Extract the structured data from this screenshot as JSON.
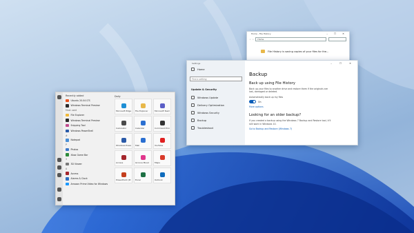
{
  "start_menu": {
    "recently_added_header": "Recently added",
    "recent": [
      {
        "label": "Ubuntu 20.04 LTS",
        "color": "#e95420"
      },
      {
        "label": "Windows Terminal Preview",
        "color": "#2b2b2b"
      }
    ],
    "most_used_header": "Most used",
    "most_used": [
      {
        "label": "File Explorer",
        "color": "#f0b93a"
      },
      {
        "label": "Windows Terminal Preview",
        "color": "#2b2b2b"
      },
      {
        "label": "Snipping Tool",
        "color": "#c14a8e"
      },
      {
        "label": "Windows PowerShell",
        "color": "#2a5aa8"
      }
    ],
    "section_hash": "#",
    "hash_items": [
      {
        "label": "Notepad",
        "color": "#4a8fd6"
      }
    ],
    "section_p": "P",
    "p_items": [
      {
        "label": "Photos",
        "color": "#3b78c9"
      },
      {
        "label": "Xbox Game Bar",
        "color": "#2c8a3a"
      }
    ],
    "section_3": "3",
    "three_items": [
      {
        "label": "3D Viewer",
        "color": "#7a7a7a"
      }
    ],
    "section_a": "A",
    "a_items": [
      {
        "label": "Access",
        "color": "#a4262c"
      },
      {
        "label": "Alarms & Clock",
        "color": "#2e6fc0"
      },
      {
        "label": "Amazon Prime Video for Windows",
        "color": "#1a98ff"
      }
    ],
    "tiles_header": "Daily",
    "tiles": [
      {
        "label": "Microsoft Edge",
        "color": "#1e8fd5"
      },
      {
        "label": "File Explorer",
        "color": "#e8b84a"
      },
      {
        "label": "Microsoft Teams",
        "color": "#5b5fc7"
      },
      {
        "label": "Calculator",
        "color": "#4a4a4a"
      },
      {
        "label": "Calendar",
        "color": "#2a6fd1"
      },
      {
        "label": "Command Prompt",
        "color": "#333333"
      },
      {
        "label": "Windows PowerShell",
        "color": "#2a5aa8"
      },
      {
        "label": "Mail",
        "color": "#2a6fd1"
      },
      {
        "label": "YouTube",
        "color": "#e02020"
      },
      {
        "label": "Access",
        "color": "#a4262c"
      },
      {
        "label": "Groove Music",
        "color": "#e0368c"
      },
      {
        "label": "Maps",
        "color": "#d93a2a"
      },
      {
        "label": "PowerPoint (Preview)",
        "color": "#c43e1c"
      },
      {
        "label": "Excel",
        "color": "#1d7044"
      },
      {
        "label": "Outlook",
        "color": "#0f6cbd"
      }
    ]
  },
  "explorer": {
    "title": "Home - File History",
    "controls": "– ☐ ✕",
    "address": "Home",
    "message": "File History is saving copies of your files for the..."
  },
  "settings": {
    "title": "Settings",
    "controls": "– ☐ ✕",
    "home": "Home",
    "search_placeholder": "Find a setting",
    "section": "Update & Security",
    "nav": [
      "Windows Update",
      "Delivery Optimization",
      "Windows Security",
      "Backup",
      "Troubleshoot"
    ],
    "heading": "Backup",
    "sub1": "Back up using File History",
    "desc1": "Back up your files to another drive and restore them if the originals are lost, damaged or deleted.",
    "auto_label": "Automatically back up my files",
    "toggle_state": "On",
    "more_options": "More options",
    "sub2": "Looking for an older backup?",
    "desc2": "If you created a backup using the Windows 7 Backup and Restore tool, it'll still work in Windows 10.",
    "restore_link": "Go to Backup and Restore (Windows 7)"
  }
}
